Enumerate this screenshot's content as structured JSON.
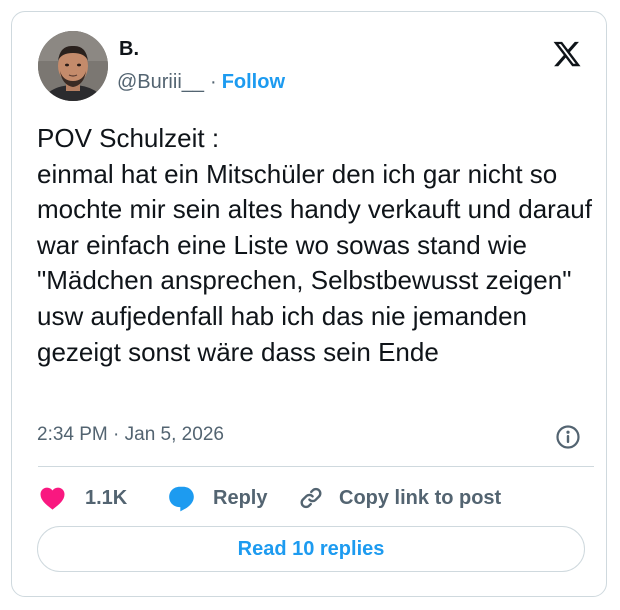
{
  "author": {
    "display_name": "B.",
    "handle": "@Buriii__",
    "separator": "·",
    "follow_label": "Follow"
  },
  "tweet": {
    "text": "POV Schulzeit :\neinmal hat ein Mitschüler den ich gar nicht so mochte mir sein altes handy verkauft und darauf war einfach eine Liste wo sowas stand wie \"Mädchen ansprechen, Selbstbewusst zeigen\" usw aufjedenfall hab ich das nie jemanden gezeigt sonst wäre dass sein Ende",
    "timestamp": "2:34 PM · Jan 5, 2026"
  },
  "actions": {
    "like_count": "1.1K",
    "reply_label": "Reply",
    "copy_link_label": "Copy link to post"
  },
  "read_replies_label": "Read 10 replies",
  "icons": {
    "brand": "x-logo-icon",
    "info": "info-icon",
    "like": "heart-icon",
    "reply": "speech-bubble-icon",
    "copy": "link-icon"
  },
  "colors": {
    "accent": "#1d9bf0",
    "like": "#f91880",
    "text_primary": "#0f1419",
    "text_secondary": "#536471",
    "border": "#cfd9de"
  }
}
